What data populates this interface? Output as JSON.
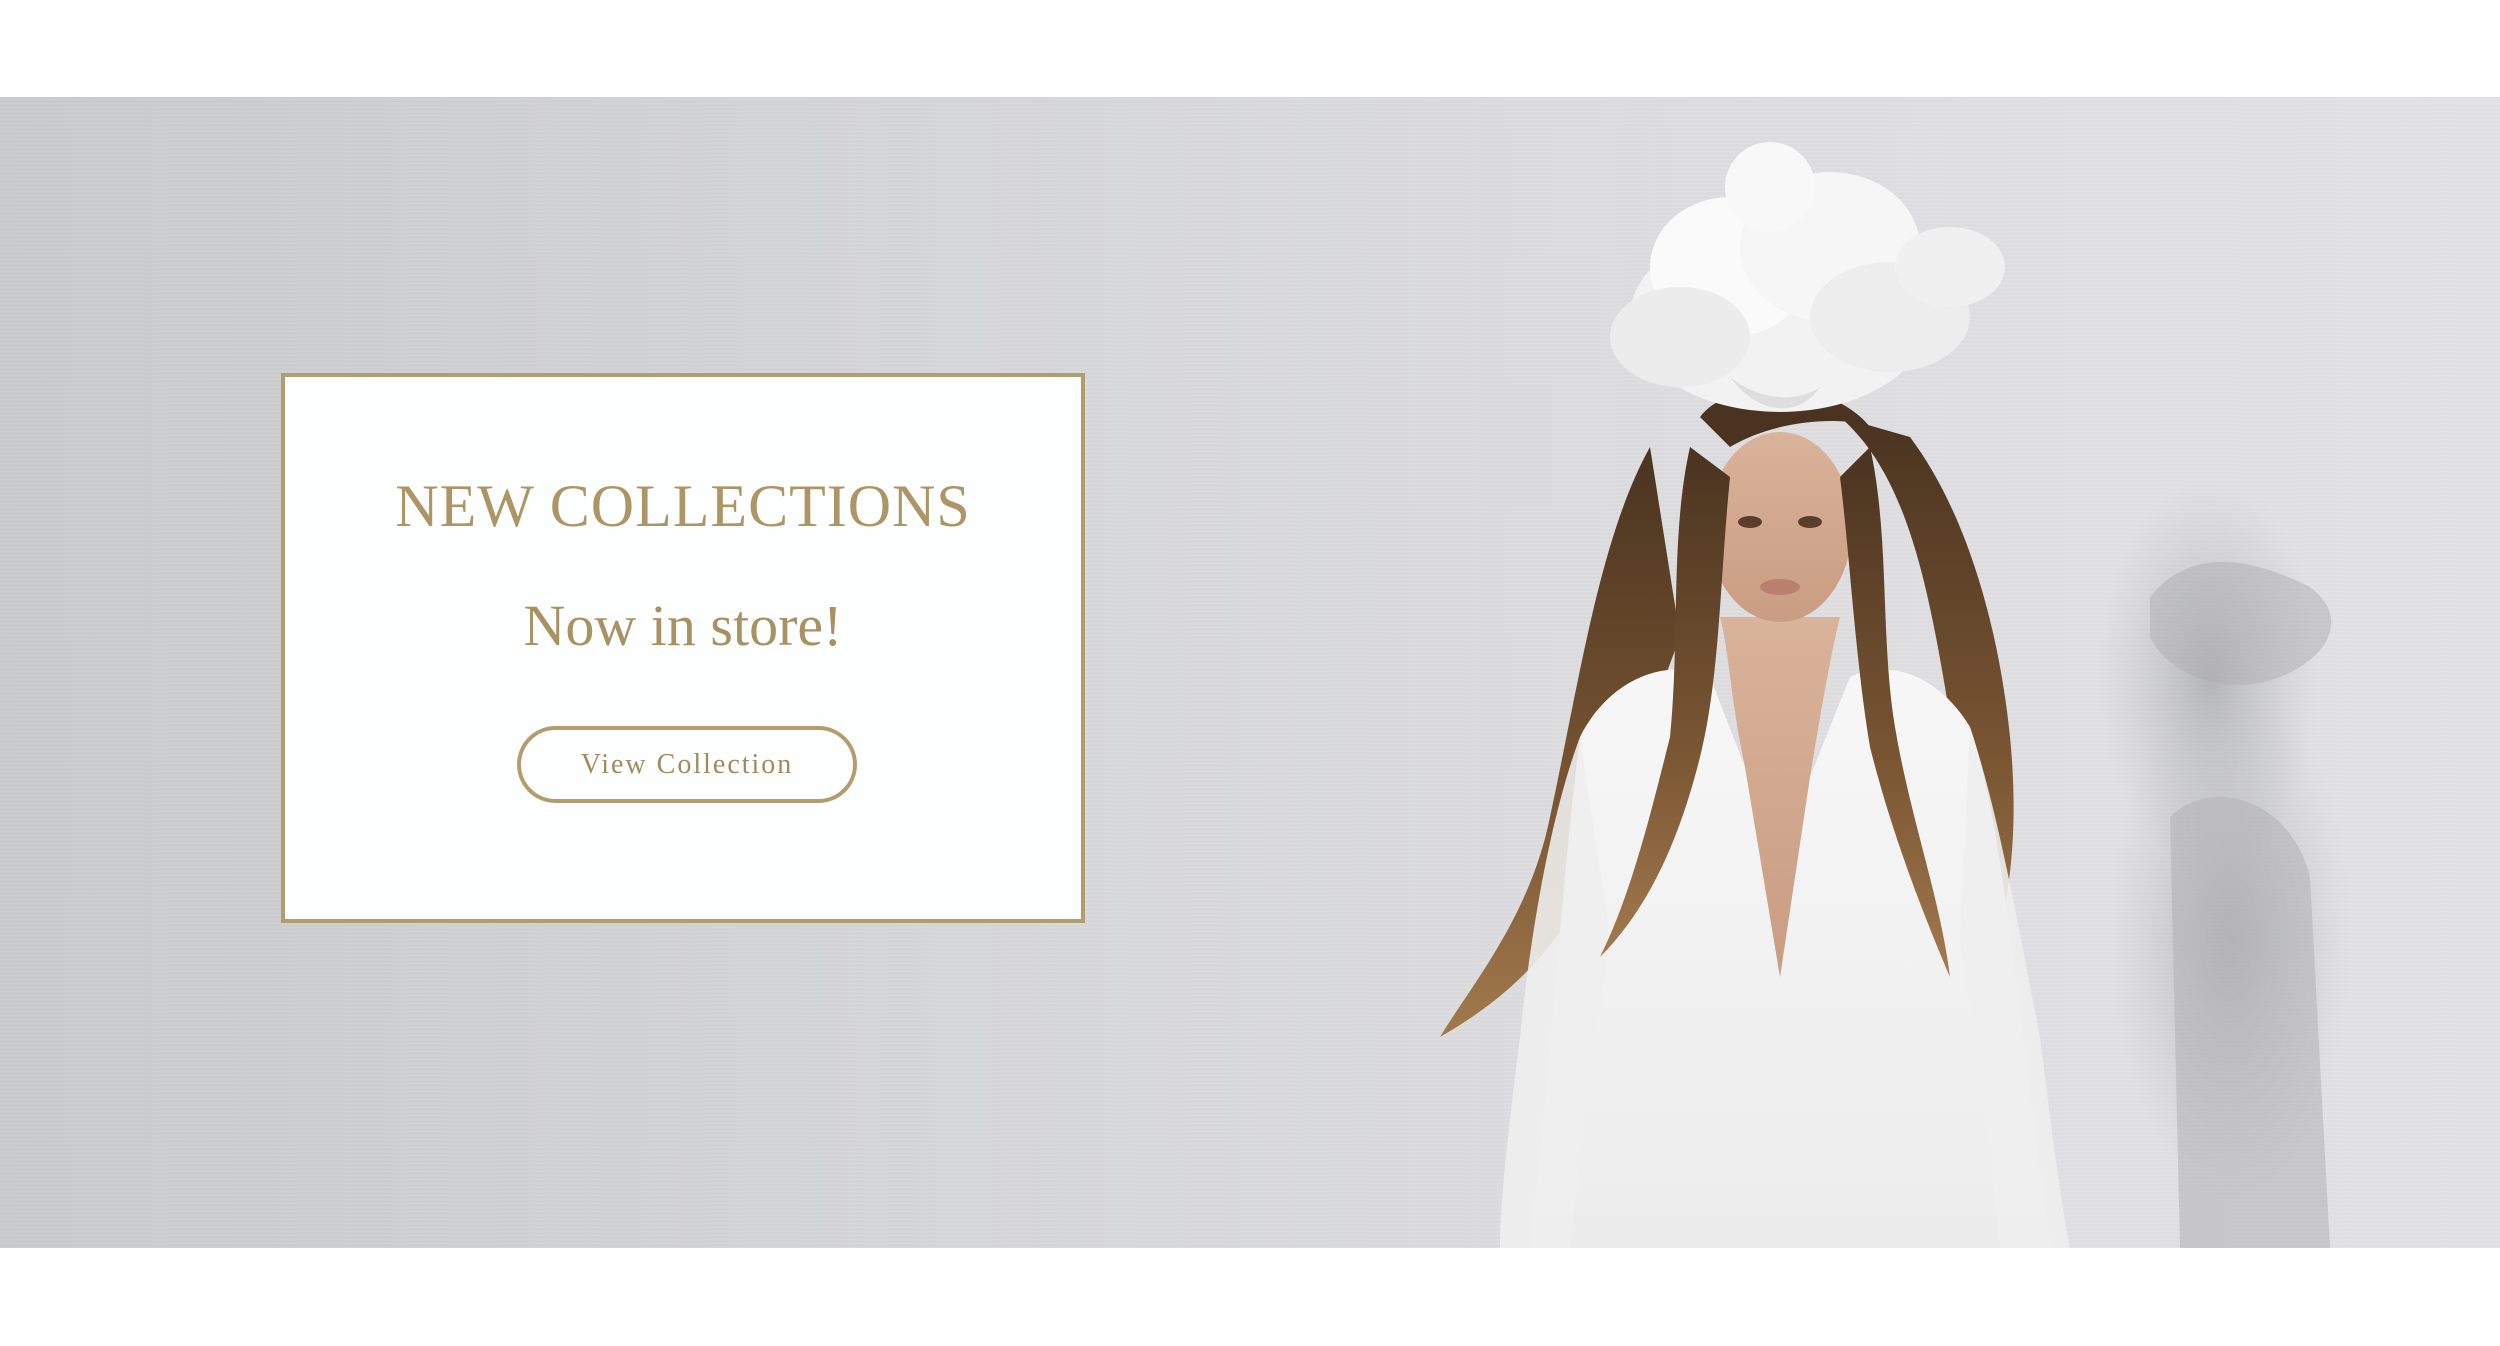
{
  "hero": {
    "background_color": "#d6d7d9",
    "accent_color": "#b39d6e"
  },
  "promo": {
    "heading": "NEW COLLECTIONS",
    "subheading": "Now in store!",
    "button_label": "View Collection"
  }
}
